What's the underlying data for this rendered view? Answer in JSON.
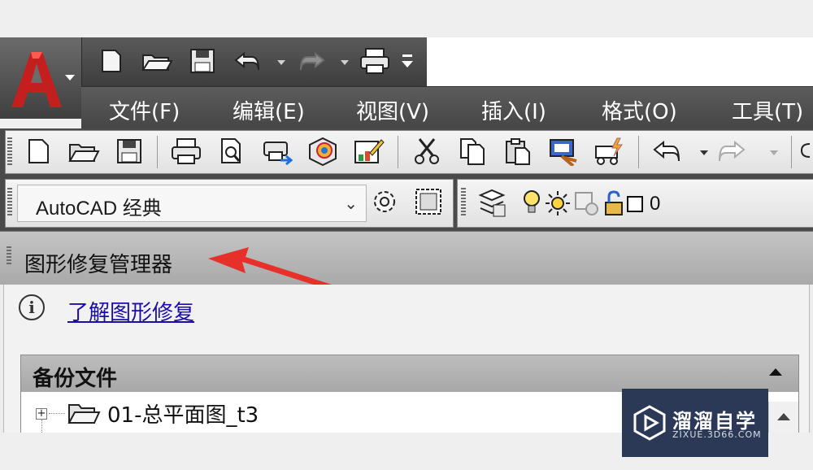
{
  "menu": {
    "items": [
      "文件(F)",
      "编辑(E)",
      "视图(V)",
      "插入(I)",
      "格式(O)",
      "工具(T)"
    ]
  },
  "workspace": {
    "selected": "AutoCAD 经典"
  },
  "layer": {
    "current": "0"
  },
  "panel": {
    "title": "图形修复管理器",
    "learn_link": "了解图形修复",
    "section_title": "备份文件",
    "files": [
      {
        "name": "01-总平面图_t3"
      }
    ]
  },
  "watermark": {
    "title": "溜溜自学",
    "subtitle": "ZIXUE.3D66.COM"
  },
  "colors": {
    "accent_red": "#e8302a",
    "link": "#1a0dab",
    "watermark_bg": "#2c3956"
  }
}
